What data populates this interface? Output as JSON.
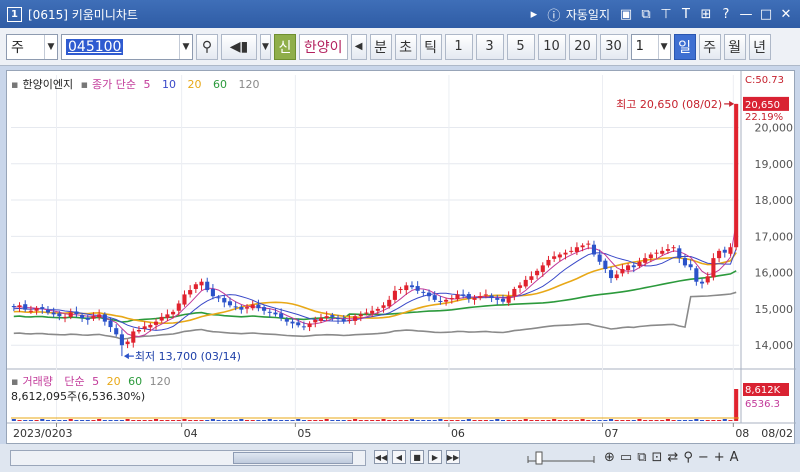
{
  "window": {
    "number": "1",
    "title": "[0615] 키움미니차트",
    "autosave_label": "자동일지"
  },
  "toolbar": {
    "period_type": "주",
    "stock_code": "045100",
    "new_label": "신",
    "stock_name": "한양이",
    "unit_buttons": [
      "분",
      "초",
      "틱"
    ],
    "interval_buttons": [
      "1",
      "3",
      "5",
      "10",
      "20",
      "30"
    ],
    "count_value": "1",
    "period_buttons": [
      "일",
      "주",
      "월",
      "년"
    ]
  },
  "price_legend": {
    "name": "한양이엔지",
    "ma_label": "종가 단순",
    "periods": [
      "5",
      "10",
      "20",
      "60",
      "120"
    ]
  },
  "volume_legend": {
    "name": "거래량",
    "ma_label": "단순",
    "periods": [
      "5",
      "20",
      "60",
      "120"
    ],
    "value_text": "8,612,095주(6,536.30%)"
  },
  "annotations": {
    "high": "최고 20,650 (08/02)",
    "low": "최저 13,700 (03/14)"
  },
  "price_axis": {
    "ticks": [
      "20,000",
      "19,000",
      "18,000",
      "17,000",
      "16,000",
      "15,000",
      "14,000"
    ],
    "current_price": "20,650",
    "top_change": "C:50.73",
    "change_pct": "22.19%"
  },
  "volume_axis": {
    "current": "8,612K",
    "ma": "6536.3"
  },
  "x_axis": {
    "labels": [
      "2023/02",
      "03",
      "04",
      "05",
      "06",
      "07",
      "08",
      "08/02"
    ]
  },
  "chart_data": {
    "type": "candlestick",
    "ylim": [
      13400,
      20950
    ],
    "colors": {
      "up": "#e0222e",
      "down": "#2b52c9",
      "ma5": "#c23a9a",
      "ma10": "#3a49c8",
      "ma20": "#e8a817",
      "ma60": "#2c9a3c",
      "ma120": "#8a8a8a"
    },
    "close": [
      15050,
      15100,
      14980,
      14950,
      15020,
      15000,
      14900,
      14850,
      14800,
      14780,
      14900,
      14860,
      14750,
      14700,
      14800,
      14850,
      14650,
      14500,
      14300,
      14000,
      14100,
      14380,
      14420,
      14520,
      14560,
      14650,
      14780,
      14850,
      14920,
      15150,
      15400,
      15520,
      15680,
      15750,
      15520,
      15350,
      15300,
      15180,
      15100,
      15050,
      14980,
      15050,
      15120,
      15020,
      14950,
      14900,
      14850,
      14750,
      14650,
      14600,
      14550,
      14500,
      14600,
      14700,
      14750,
      14800,
      14780,
      14720,
      14650,
      14700,
      14800,
      14850,
      14900,
      14950,
      15000,
      15100,
      15250,
      15500,
      15550,
      15650,
      15600,
      15500,
      15450,
      15350,
      15250,
      15200,
      15250,
      15300,
      15400,
      15380,
      15280,
      15300,
      15350,
      15400,
      15300,
      15250,
      15200,
      15350,
      15550,
      15650,
      15800,
      15900,
      16050,
      16200,
      16350,
      16450,
      16500,
      16550,
      16600,
      16700,
      16750,
      16800,
      16500,
      16300,
      16100,
      15850,
      15950,
      16100,
      16200,
      16150,
      16300,
      16400,
      16500,
      16550,
      16600,
      16650,
      16700,
      16400,
      16200,
      16150,
      15750,
      15700,
      15900,
      16400,
      16600,
      16550,
      16700,
      20650
    ]
  },
  "bottom": {
    "zoom_labels": [
      "−",
      "+",
      "A"
    ]
  }
}
